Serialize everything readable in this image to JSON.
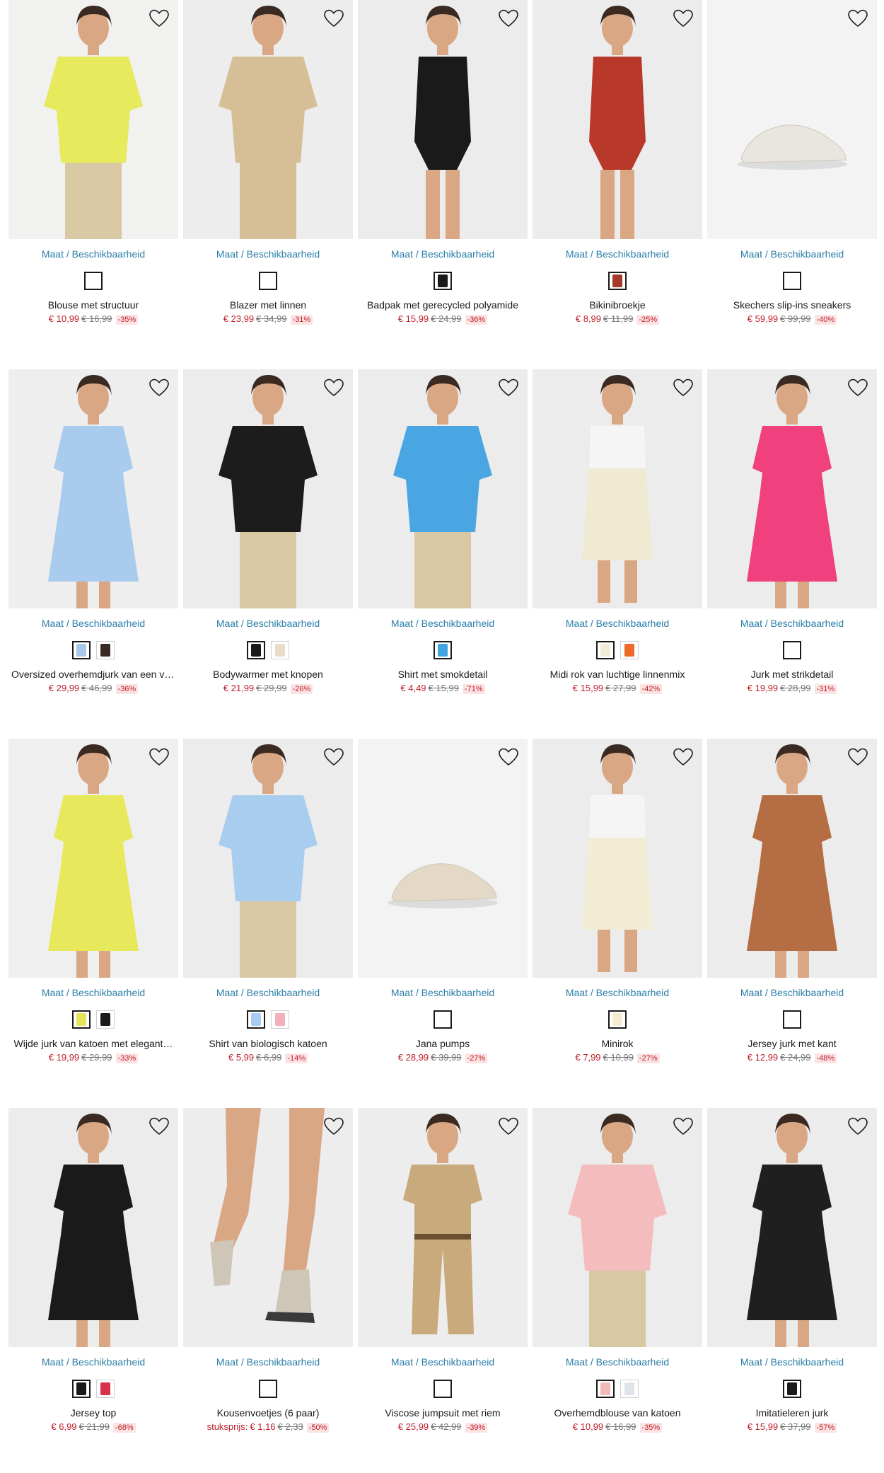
{
  "size_link_label": "Maat / Beschikbaarheid",
  "products": [
    {
      "name": "Blouse met structuur",
      "price": "€ 10,99",
      "old_price": "€ 16,99",
      "discount": "-35%",
      "swatches": [],
      "photo_bg": "#f1f1ef",
      "garment": "#e6ea5c",
      "kind": "top"
    },
    {
      "name": "Blazer met linnen",
      "price": "€ 23,99",
      "old_price": "€ 34,99",
      "discount": "-31%",
      "swatches": [],
      "photo_bg": "#ededed",
      "garment": "#d6bf96",
      "kind": "jacket"
    },
    {
      "name": "Badpak met gerecycled polyamide",
      "price": "€ 15,99",
      "old_price": "€ 24,99",
      "discount": "-36%",
      "swatches": [
        "#1a1a1a"
      ],
      "photo_bg": "#ececec",
      "garment": "#1a1a1a",
      "kind": "swim"
    },
    {
      "name": "Bikinibroekje",
      "price": "€ 8,99",
      "old_price": "€ 11,99",
      "discount": "-25%",
      "swatches": [
        "#a33a2a"
      ],
      "photo_bg": "#ececec",
      "garment": "#b8382a",
      "kind": "swim"
    },
    {
      "name": "Skechers slip-ins sneakers",
      "price": "€ 59,99",
      "old_price": "€ 99,99",
      "discount": "-40%",
      "swatches": [],
      "photo_bg": "#f3f3f3",
      "garment": "#e9e5df",
      "kind": "shoe"
    },
    {
      "name": "Oversized overhemdjurk van een vi…",
      "price": "€ 29,99",
      "old_price": "€ 46,99",
      "discount": "-36%",
      "swatches": [
        "#a8c8ea",
        "#3a2a26"
      ],
      "photo_bg": "#eeeeee",
      "garment": "#a9cbee",
      "kind": "dress"
    },
    {
      "name": "Bodywarmer met knopen",
      "price": "€ 21,99",
      "old_price": "€ 29,99",
      "discount": "-26%",
      "swatches": [
        "#1a1a1a",
        "#e9dcc6"
      ],
      "photo_bg": "#ececec",
      "garment": "#1c1c1c",
      "kind": "top"
    },
    {
      "name": "Shirt met smokdetail",
      "price": "€ 4,49",
      "old_price": "€ 15,99",
      "discount": "-71%",
      "swatches": [
        "#3fa4e0"
      ],
      "photo_bg": "#ececec",
      "garment": "#4aa6e2",
      "kind": "top"
    },
    {
      "name": "Midi rok van luchtige linnenmix",
      "price": "€ 15,99",
      "old_price": "€ 27,99",
      "discount": "-42%",
      "swatches": [
        "#f2ecd6",
        "#ee6a28"
      ],
      "photo_bg": "#ececec",
      "garment": "#f1ead2",
      "kind": "skirt"
    },
    {
      "name": "Jurk met strikdetail",
      "price": "€ 19,99",
      "old_price": "€ 28,99",
      "discount": "-31%",
      "swatches": [],
      "photo_bg": "#ececec",
      "garment": "#f0407e",
      "kind": "dress"
    },
    {
      "name": "Wijde jurk van katoen met elegant…",
      "price": "€ 19,99",
      "old_price": "€ 29,99",
      "discount": "-33%",
      "swatches": [
        "#e6e55a",
        "#1a1a1a"
      ],
      "photo_bg": "#efefef",
      "garment": "#e8e85c",
      "kind": "dress"
    },
    {
      "name": "Shirt van biologisch katoen",
      "price": "€ 5,99",
      "old_price": "€ 6,99",
      "discount": "-14%",
      "swatches": [
        "#a9cdee",
        "#f1b0bc"
      ],
      "photo_bg": "#ececec",
      "garment": "#a9cdee",
      "kind": "top"
    },
    {
      "name": "Jana pumps",
      "price": "€ 28,99",
      "old_price": "€ 39,99",
      "discount": "-27%",
      "swatches": [],
      "photo_bg": "#f3f3f3",
      "garment": "#e3d9c6",
      "kind": "shoe"
    },
    {
      "name": "Minirok",
      "price": "€ 7,99",
      "old_price": "€ 10,99",
      "discount": "-27%",
      "swatches": [
        "#f3ecd3"
      ],
      "photo_bg": "#ececec",
      "garment": "#f2ecd5",
      "kind": "skirt"
    },
    {
      "name": "Jersey jurk met kant",
      "price": "€ 12,99",
      "old_price": "€ 24,99",
      "discount": "-48%",
      "swatches": [],
      "photo_bg": "#ececec",
      "garment": "#b56d44",
      "kind": "dress"
    },
    {
      "name": "Jersey top",
      "price": "€ 6,99",
      "old_price": "€ 21,99",
      "discount": "-68%",
      "swatches": [
        "#1a1a1a",
        "#d8324a"
      ],
      "photo_bg": "#ececec",
      "garment": "#1a1a1a",
      "kind": "dress"
    },
    {
      "name": "Kousenvoetjes (6 paar)",
      "unit_label": "stuksprijs:",
      "price": "€ 1,16",
      "old_price": "€ 2,33",
      "discount": "-50%",
      "swatches": [],
      "photo_bg": "#ededed",
      "garment": "#3a3a3a",
      "kind": "sock"
    },
    {
      "name": "Viscose jumpsuit met riem",
      "price": "€ 25,99",
      "old_price": "€ 42,99",
      "discount": "-39%",
      "swatches": [],
      "photo_bg": "#ededed",
      "garment": "#c9aa7c",
      "kind": "jumpsuit"
    },
    {
      "name": "Overhemdblouse van katoen",
      "price": "€ 10,99",
      "old_price": "€ 16,99",
      "discount": "-35%",
      "swatches": [
        "#f2b9b9",
        "#dfe3ea"
      ],
      "photo_bg": "#ececec",
      "garment": "#f4bcbc",
      "kind": "top"
    },
    {
      "name": "Imitatieleren jurk",
      "price": "€ 15,99",
      "old_price": "€ 37,99",
      "discount": "-57%",
      "swatches": [
        "#1a1a1a"
      ],
      "photo_bg": "#ececec",
      "garment": "#1f1f1f",
      "kind": "dress"
    }
  ]
}
